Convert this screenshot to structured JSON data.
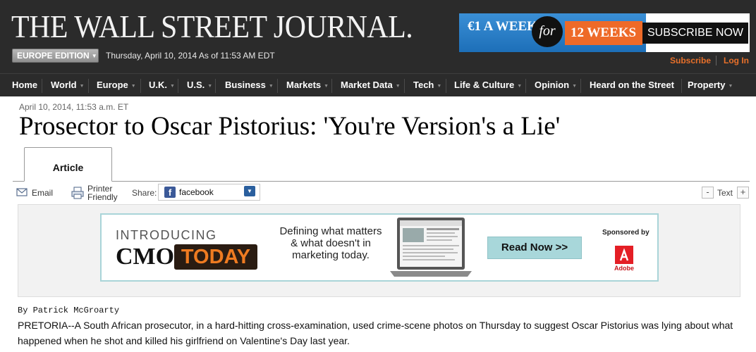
{
  "masthead": {
    "logo": "THE WALL STREET JOURNAL.",
    "edition": "EUROPE EDITION",
    "dateline": "Thursday, April 10, 2014 As of 11:53 AM EDT"
  },
  "promo": {
    "price": "€1 A WEEK",
    "for": "for",
    "weeks": "12 WEEKS",
    "cta": "SUBSCRIBE NOW",
    "accent": "#1d6fb8",
    "orange": "#ee6a28"
  },
  "user_links": {
    "subscribe": "Subscribe",
    "login": "Log In"
  },
  "nav": [
    {
      "label": "Home",
      "has_menu": false
    },
    {
      "label": "World",
      "has_menu": true
    },
    {
      "label": "Europe",
      "has_menu": true
    },
    {
      "label": "U.K.",
      "has_menu": true
    },
    {
      "label": "U.S.",
      "has_menu": true
    },
    {
      "label": "Business",
      "has_menu": true
    },
    {
      "label": "Markets",
      "has_menu": true
    },
    {
      "label": "Market Data",
      "has_menu": true
    },
    {
      "label": "Tech",
      "has_menu": true
    },
    {
      "label": "Life & Culture",
      "has_menu": true
    },
    {
      "label": "Opinion",
      "has_menu": true
    },
    {
      "label": "Heard on the Street",
      "has_menu": false
    },
    {
      "label": "Property",
      "has_menu": true
    }
  ],
  "article": {
    "timestamp": "April 10, 2014, 11:53 a.m. ET",
    "headline": "Prosector to Oscar Pistorius: 'You're Version's a Lie'",
    "tab": "Article",
    "byline": "By Patrick McGroarty",
    "body": "PRETORIA--A South African prosecutor, in a hard-hitting cross-examination, used crime-scene photos on Thursday to suggest Oscar Pistorius was lying about what happened when he shot and killed his girlfriend on Valentine's Day last year."
  },
  "tools": {
    "email": "Email",
    "print_line1": "Printer",
    "print_line2": "Friendly",
    "share_label": "Share:",
    "share_service": "facebook",
    "text_minus": "-",
    "text_label": "Text",
    "text_plus": "+"
  },
  "ad": {
    "intro": "INTRODUCING",
    "cmo": "CMO",
    "today": "TODAY",
    "copy_line1": "Defining what matters",
    "copy_line2": "& what doesn't in",
    "copy_line3": "marketing today.",
    "cta": "Read Now >>",
    "sponsored": "Sponsored by",
    "sponsor": "Adobe"
  },
  "icons": {
    "email": "envelope-icon",
    "print": "printer-icon",
    "facebook": "facebook-icon",
    "dropdown": "chevron-down-icon"
  }
}
